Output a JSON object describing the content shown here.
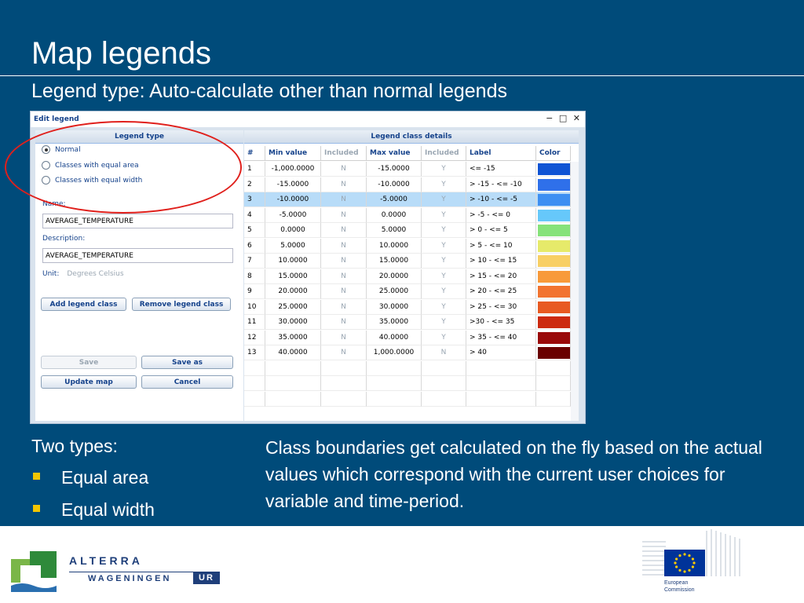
{
  "slide": {
    "title": "Map legends",
    "subtitle": "Legend type: Auto-calculate other than normal legends"
  },
  "dialog": {
    "title": "Edit legend",
    "window_controls": [
      "−",
      "□",
      "✕"
    ],
    "left_panel": {
      "header": "Legend type",
      "radios": [
        {
          "label": "Normal",
          "checked": true
        },
        {
          "label": "Classes with equal area",
          "checked": false
        },
        {
          "label": "Classes with equal width",
          "checked": false
        }
      ],
      "name_label": "Name:",
      "name_value": "AVERAGE_TEMPERATURE",
      "description_label": "Description:",
      "description_value": "AVERAGE_TEMPERATURE",
      "unit_label": "Unit:",
      "unit_value": "Degrees Celsius",
      "add_class_label": "Add legend class",
      "remove_class_label": "Remove legend class",
      "save_label": "Save",
      "save_as_label": "Save as",
      "update_map_label": "Update map",
      "cancel_label": "Cancel"
    },
    "right_panel": {
      "header": "Legend class details",
      "columns": [
        "#",
        "Min value",
        "Included",
        "Max value",
        "Included",
        "Label",
        "Color"
      ],
      "selected_row": 3,
      "rows": [
        {
          "num": "1",
          "min": "-1,000.0000",
          "min_inc": "N",
          "max": "-15.0000",
          "max_inc": "Y",
          "label": "<= -15",
          "color": "#1054d4"
        },
        {
          "num": "2",
          "min": "-15.0000",
          "min_inc": "N",
          "max": "-10.0000",
          "max_inc": "Y",
          "label": "> -15 - <= -10",
          "color": "#2f70ea"
        },
        {
          "num": "3",
          "min": "-10.0000",
          "min_inc": "N",
          "max": "-5.0000",
          "max_inc": "Y",
          "label": "> -10 - <= -5",
          "color": "#3d8ff2"
        },
        {
          "num": "4",
          "min": "-5.0000",
          "min_inc": "N",
          "max": "0.0000",
          "max_inc": "Y",
          "label": "> -5 - <= 0",
          "color": "#66c8fa"
        },
        {
          "num": "5",
          "min": "0.0000",
          "min_inc": "N",
          "max": "5.0000",
          "max_inc": "Y",
          "label": "> 0 - <= 5",
          "color": "#86e27a"
        },
        {
          "num": "6",
          "min": "5.0000",
          "min_inc": "N",
          "max": "10.0000",
          "max_inc": "Y",
          "label": "> 5 - <= 10",
          "color": "#e6ea6a"
        },
        {
          "num": "7",
          "min": "10.0000",
          "min_inc": "N",
          "max": "15.0000",
          "max_inc": "Y",
          "label": "> 10 - <= 15",
          "color": "#f8cf64"
        },
        {
          "num": "8",
          "min": "15.0000",
          "min_inc": "N",
          "max": "20.0000",
          "max_inc": "Y",
          "label": "> 15 - <= 20",
          "color": "#f89a3a"
        },
        {
          "num": "9",
          "min": "20.0000",
          "min_inc": "N",
          "max": "25.0000",
          "max_inc": "Y",
          "label": "> 20 - <= 25",
          "color": "#f27430"
        },
        {
          "num": "10",
          "min": "25.0000",
          "min_inc": "N",
          "max": "30.0000",
          "max_inc": "Y",
          "label": "> 25 - <= 30",
          "color": "#e85a22"
        },
        {
          "num": "11",
          "min": "30.0000",
          "min_inc": "N",
          "max": "35.0000",
          "max_inc": "Y",
          "label": ">30 - <= 35",
          "color": "#cc2a10"
        },
        {
          "num": "12",
          "min": "35.0000",
          "min_inc": "N",
          "max": "40.0000",
          "max_inc": "Y",
          "label": "> 35 - <= 40",
          "color": "#9a0a0a"
        },
        {
          "num": "13",
          "min": "40.0000",
          "min_inc": "N",
          "max": "1,000.0000",
          "max_inc": "N",
          "label": "> 40",
          "color": "#6a0000"
        }
      ]
    }
  },
  "body": {
    "two_types_heading": "Two types:",
    "bullets": [
      "Equal area",
      "Equal width"
    ],
    "description": "Class boundaries get calculated on the fly based on the actual values which correspond with the current user choices for variable and time-period."
  },
  "footer": {
    "alterra_text": "ALTERRA",
    "wageningen_text": "WAGENINGEN",
    "ur_text": "UR",
    "ec_text_line1": "European",
    "ec_text_line2": "Commission"
  },
  "colors": {
    "background": "#004b7a",
    "highlight_ellipse": "#e0201c",
    "bullet": "#f2c500",
    "selected_row": "#b8dcf8"
  }
}
